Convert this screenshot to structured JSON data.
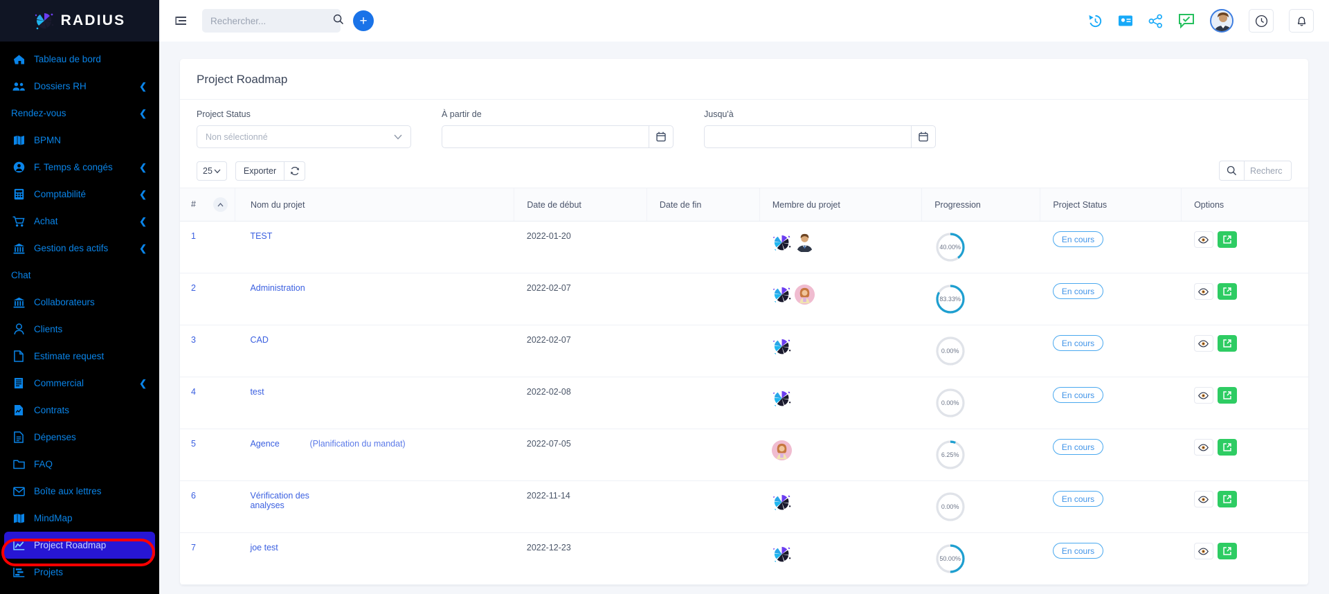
{
  "brand": {
    "name": "RADIUS"
  },
  "sidebar": {
    "items": [
      {
        "label": "Tableau de bord",
        "icon": "home-icon",
        "caret": false,
        "active": false
      },
      {
        "label": "Dossiers RH",
        "icon": "people-icon",
        "caret": true,
        "active": false
      },
      {
        "label": "Rendez-vous",
        "icon": "",
        "caret": true,
        "active": false
      },
      {
        "label": "BPMN",
        "icon": "book-icon",
        "caret": false,
        "active": false
      },
      {
        "label": "F. Temps & congés",
        "icon": "user-circle-icon",
        "caret": true,
        "active": false
      },
      {
        "label": "Comptabilité",
        "icon": "calculator-icon",
        "caret": true,
        "active": false
      },
      {
        "label": "Achat",
        "icon": "cart-icon",
        "caret": true,
        "active": false
      },
      {
        "label": "Gestion des actifs",
        "icon": "bank-icon",
        "caret": true,
        "active": false
      },
      {
        "label": "Chat",
        "icon": "",
        "caret": false,
        "active": false
      },
      {
        "label": "Collaborateurs",
        "icon": "bank-icon",
        "caret": false,
        "active": false
      },
      {
        "label": "Clients",
        "icon": "user-icon",
        "caret": false,
        "active": false
      },
      {
        "label": "Estimate request",
        "icon": "file-icon",
        "caret": false,
        "active": false
      },
      {
        "label": "Commercial",
        "icon": "receipt-icon",
        "caret": true,
        "active": false
      },
      {
        "label": "Contrats",
        "icon": "contract-icon",
        "caret": false,
        "active": false
      },
      {
        "label": "Dépenses",
        "icon": "doc-lines-icon",
        "caret": false,
        "active": false
      },
      {
        "label": "FAQ",
        "icon": "folder-icon",
        "caret": false,
        "active": false
      },
      {
        "label": "Boîte aux lettres",
        "icon": "envelope-icon",
        "caret": false,
        "active": false
      },
      {
        "label": "MindMap",
        "icon": "book-icon",
        "caret": false,
        "active": false
      },
      {
        "label": "Project Roadmap",
        "icon": "chart-line-icon",
        "caret": false,
        "active": true
      },
      {
        "label": "Projets",
        "icon": "project-icon",
        "caret": false,
        "active": false
      }
    ]
  },
  "topbar": {
    "search_placeholder": "Rechercher...",
    "add_label": "+",
    "icons": [
      "history-icon",
      "id-card-icon",
      "share-icon",
      "chat-check-icon",
      "avatar",
      "clock-icon",
      "bell-icon"
    ]
  },
  "page": {
    "title": "Project Roadmap"
  },
  "filters": {
    "status_label": "Project Status",
    "status_value": "Non sélectionné",
    "from_label": "À partir de",
    "from_value": "",
    "to_label": "Jusqu'à",
    "to_value": ""
  },
  "toolbar": {
    "page_length": "25",
    "export_label": "Exporter",
    "refresh_icon": "refresh-icon",
    "search_placeholder": "Recherc",
    "search_value": ""
  },
  "table": {
    "columns": [
      "#",
      "Nom du projet",
      "Date de début",
      "Date de fin",
      "Membre du projet",
      "Progression",
      "Project Status",
      "Options"
    ],
    "rows": [
      {
        "num": "1",
        "name": "TEST",
        "sub": "",
        "start": "2022-01-20",
        "end": "",
        "members": [
          "logo",
          "man"
        ],
        "progress": 40.0,
        "progress_label": "40.00%",
        "status": "En cours"
      },
      {
        "num": "2",
        "name": "Administration",
        "sub": "",
        "start": "2022-02-07",
        "end": "",
        "members": [
          "logo",
          "woman"
        ],
        "progress": 83.33,
        "progress_label": "83.33%",
        "status": "En cours"
      },
      {
        "num": "3",
        "name": "CAD",
        "sub": "",
        "start": "2022-02-07",
        "end": "",
        "members": [
          "logo"
        ],
        "progress": 0.0,
        "progress_label": "0.00%",
        "status": "En cours"
      },
      {
        "num": "4",
        "name": "test",
        "sub": "",
        "start": "2022-02-08",
        "end": "",
        "members": [
          "logo"
        ],
        "progress": 0.0,
        "progress_label": "0.00%",
        "status": "En cours"
      },
      {
        "num": "5",
        "name": "Agence",
        "sub": "(Planification du mandat)",
        "start": "2022-07-05",
        "end": "",
        "members": [
          "woman"
        ],
        "progress": 6.25,
        "progress_label": "6.25%",
        "status": "En cours"
      },
      {
        "num": "6",
        "name": "Vérification des analyses",
        "sub": "",
        "start": "2022-11-14",
        "end": "",
        "members": [
          "logo"
        ],
        "progress": 0.0,
        "progress_label": "0.00%",
        "status": "En cours"
      },
      {
        "num": "7",
        "name": "joe test",
        "sub": "",
        "start": "2022-12-23",
        "end": "",
        "members": [
          "logo"
        ],
        "progress": 50.0,
        "progress_label": "50.00%",
        "status": "En cours"
      }
    ]
  },
  "colors": {
    "accent": "#1a73e8",
    "sidebar_bg": "#000000",
    "active_item": "#2716d4",
    "link": "#3a5fe0",
    "progress": "#1e9fd0",
    "badge": "#3f93e8",
    "go_button": "#2ecc63",
    "annotation": "#ff0000"
  }
}
